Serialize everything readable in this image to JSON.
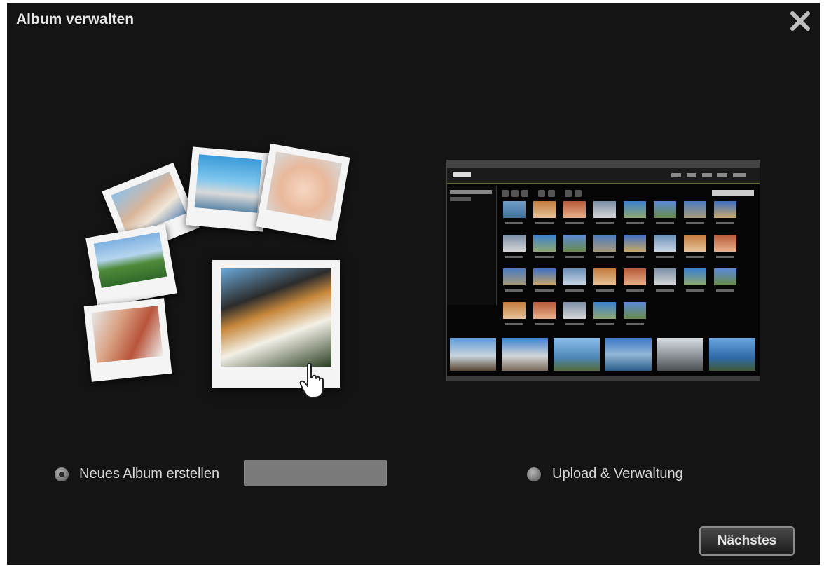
{
  "dialog": {
    "title": "Album verwalten",
    "close_icon": "close-icon"
  },
  "options": {
    "new_album_label": "Neues Album erstellen",
    "new_album_value": "",
    "upload_label": "Upload & Verwaltung"
  },
  "footer": {
    "next_label": "Nächstes"
  },
  "colors": {
    "background": "#141414",
    "text": "#d8d8d8",
    "input": "#7a7a7a"
  }
}
